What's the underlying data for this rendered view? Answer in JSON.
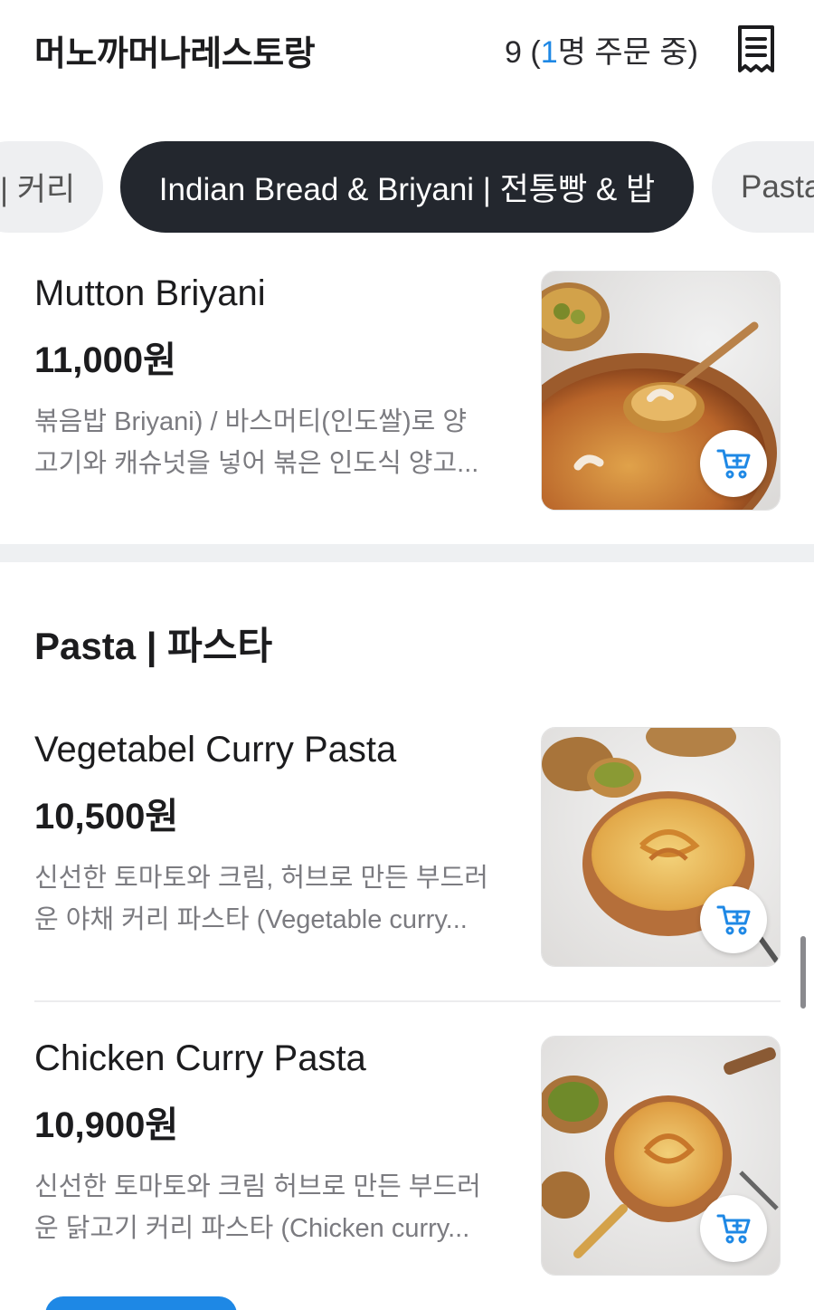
{
  "header": {
    "store_name": "머노까머나레스토랑",
    "order_count_prefix": "9 (",
    "order_count_accent": "1",
    "order_count_suffix": "명 주문 중)",
    "receipt_icon": "receipt-icon"
  },
  "tabs": [
    {
      "label": "| 커리",
      "active": false
    },
    {
      "label": "Indian Bread & Briyani | 전통빵 & 밥",
      "active": true
    },
    {
      "label": "Pasta",
      "active": false
    }
  ],
  "items": [
    {
      "name": "Mutton Briyani",
      "price": "11,000원",
      "desc_line1": "볶음밥 Briyani) / 바스머티(인도쌀)로 양",
      "desc_line2": "고기와 캐슈넛을 넣어 볶은 인도식 양고...",
      "photo_icon": "briyani-photo"
    },
    {
      "name": "Vegetabel Curry Pasta",
      "price": "10,500원",
      "desc_line1": "신선한 토마토와 크림, 허브로 만든 부드러",
      "desc_line2": "운 야채 커리 파스타 (Vegetable curry...",
      "photo_icon": "pasta-photo"
    },
    {
      "name": "Chicken Curry Pasta",
      "price": "10,900원",
      "desc_line1": "신선한 토마토와 크림 허브로 만든 부드러",
      "desc_line2": "운 닭고기 커리 파스타 (Chicken curry...",
      "photo_icon": "pasta-photo"
    }
  ],
  "section": {
    "title": "Pasta | 파스타"
  },
  "colors": {
    "accent": "#1e88e5",
    "active_tab": "#23272e",
    "price_text": "#1c1c1e",
    "desc_text": "#7b7b80"
  }
}
